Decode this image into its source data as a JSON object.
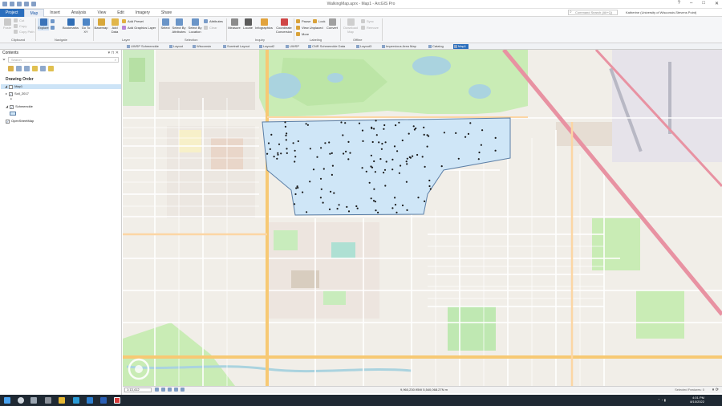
{
  "window": {
    "title": "WalkingMap.aprx - Map1 - ArcGIS Pro"
  },
  "ribbon_tabs": [
    "Project",
    "Map",
    "Insert",
    "Analysis",
    "View",
    "Edit",
    "Imagery",
    "Share"
  ],
  "command_search": {
    "placeholder": "Command Search (Alt+Q)"
  },
  "account": {
    "label": "Katherine (University of Wisconsin-Stevens Point)"
  },
  "ribbon": {
    "clipboard": {
      "label": "Clipboard",
      "paste": "Paste",
      "cut": "Cut",
      "copy": "Copy",
      "copy_path": "Copy Path"
    },
    "navigate": {
      "label": "Navigate",
      "explore": "Explore",
      "bookmarks": "Bookmarks",
      "go_to_xy": "Go To XY"
    },
    "layer": {
      "label": "Layer",
      "basemap": "Basemap",
      "add_data": "Add Data",
      "add_preset": "Add Preset",
      "add_graphics_layer": "Add Graphics Layer"
    },
    "selection": {
      "label": "Selection",
      "select": "Select",
      "select_by_attributes": "Select By Attributes",
      "select_by_location": "Select By Location",
      "attributes": "Attributes",
      "clear": "Clear"
    },
    "inquiry": {
      "label": "Inquiry",
      "measure": "Measure",
      "locate": "Locate",
      "infographics": "Infographics",
      "coordinate_conversion": "Coordinate Conversion"
    },
    "labeling": {
      "label": "Labeling",
      "pause": "Pause",
      "lock": "Lock",
      "view_unplaced": "View Unplaced",
      "more": "More",
      "convert": "Convert"
    },
    "offline": {
      "label": "Offline",
      "download_map": "Download Map",
      "sync": "Sync",
      "remove": "Remove"
    }
  },
  "view_tabs": [
    {
      "label": "UWSP Schmeeckle",
      "active": false
    },
    {
      "label": "Layout",
      "active": false
    },
    {
      "label": "Wisconsin",
      "active": false
    },
    {
      "label": "Suretrail Layout",
      "active": false
    },
    {
      "label": "Layout2",
      "active": false
    },
    {
      "label": "UWSP",
      "active": false
    },
    {
      "label": "CNR Schmeeckle Data",
      "active": false
    },
    {
      "label": "Layout3",
      "active": false
    },
    {
      "label": "Impervious Area Map",
      "active": false
    },
    {
      "label": "Catalog",
      "active": false
    },
    {
      "label": "Map1",
      "active": true
    }
  ],
  "contents": {
    "title": "Contents",
    "search_placeholder": "Search",
    "drawing_order_label": "Drawing Order",
    "layers": [
      {
        "name": "Map1",
        "checked": true,
        "selected": true
      },
      {
        "name": "Soil_2017",
        "checked": true,
        "selected": false
      },
      {
        "name": "Schmeeckle",
        "checked": true,
        "selected": false
      },
      {
        "name": "OpenStreetMap",
        "checked": true,
        "selected": false
      }
    ]
  },
  "map": {
    "polygon_fill": "#cfe6f7",
    "polygon_stroke": "#5c7fa6",
    "sample_point_color": "#1a1a1a",
    "basemap_water": "#aad3df",
    "basemap_park": "#c8f0c0"
  },
  "status": {
    "scale": "1:13,412",
    "coordinates": "9,960,230.95W 5,540,068.27N m",
    "selected_features": "Selected Features: 0"
  },
  "taskbar": {
    "time": "4:01 PM",
    "date": "8/10/2022"
  }
}
